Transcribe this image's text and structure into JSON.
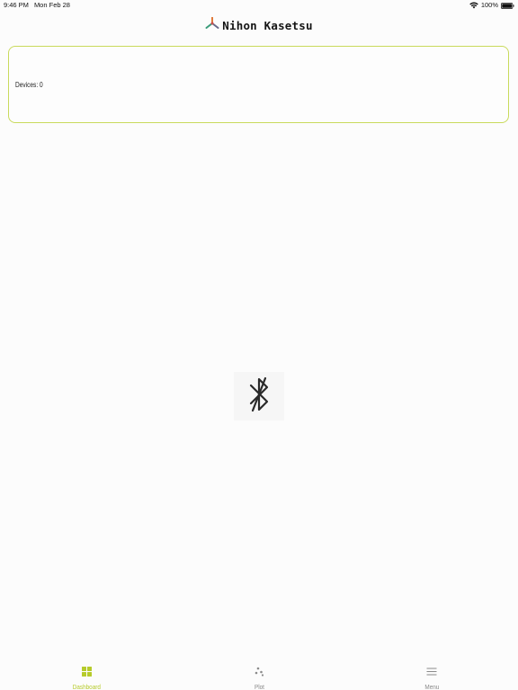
{
  "status_bar": {
    "time": "9:46 PM",
    "date": "Mon Feb 28",
    "battery": "100%",
    "icons": [
      "wifi-icon",
      "battery-icon"
    ]
  },
  "header": {
    "title": "Nihon Kasetsu",
    "logo_icon": "tripod-logo-icon"
  },
  "devices_card": {
    "label": "Devices: 0",
    "border_color": "#c9da5c"
  },
  "center": {
    "icon": "bluetooth-disabled-icon"
  },
  "tabs": [
    {
      "label": "Dashboard",
      "icon": "grid-icon",
      "active": true
    },
    {
      "label": "Plot",
      "icon": "scatter-dots-icon",
      "active": false
    },
    {
      "label": "Menu",
      "icon": "hamburger-icon",
      "active": false
    }
  ],
  "colors": {
    "accent": "#b6cb2b",
    "inactive": "#8a8a8a"
  }
}
